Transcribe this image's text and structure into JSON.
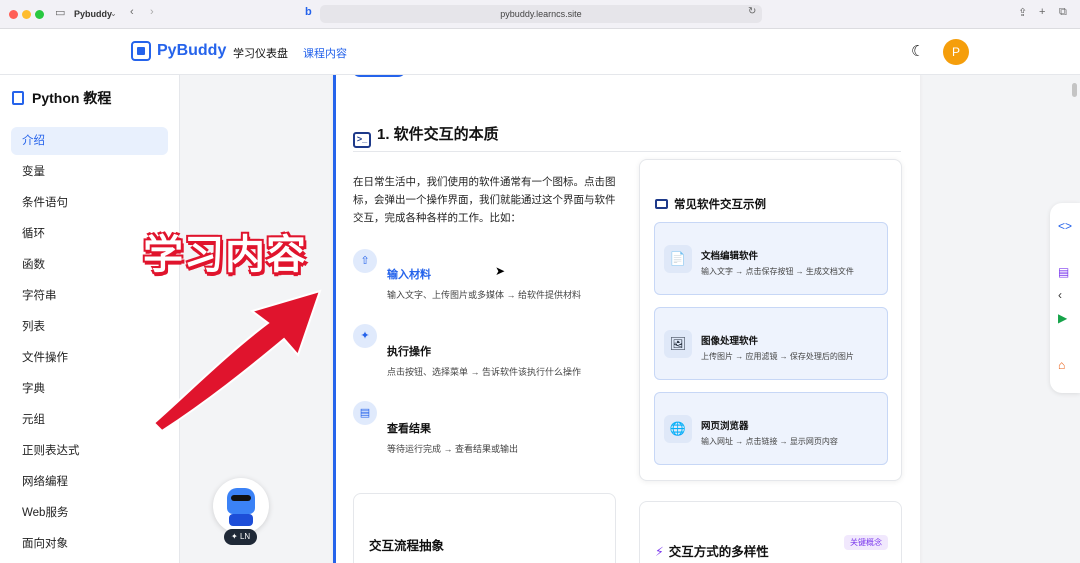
{
  "browser": {
    "tab_title": "Pybuddy",
    "url": "pybuddy.learncs.site",
    "colors": {
      "close": "#ff5f57",
      "minimize": "#febc2e",
      "maximize": "#28c840"
    }
  },
  "header": {
    "brand": "PyBuddy",
    "nav": [
      "学习仪表盘",
      "课程内容"
    ],
    "active_nav": "课程内容",
    "avatar_letter": "P",
    "accent": "#2563eb"
  },
  "sidebar": {
    "title": "Python 教程",
    "items": [
      "介绍",
      "变量",
      "条件语句",
      "循环",
      "函数",
      "字符串",
      "列表",
      "文件操作",
      "字典",
      "元组",
      "正则表达式",
      "网络编程",
      "Web服务",
      "面向对象"
    ],
    "active_item": "介绍"
  },
  "main": {
    "section_title": "1. 软件交互的本质",
    "intro": "在日常生活中，我们使用的软件通常有一个图标。点击图标，会弹出一个操作界面，我们就能通过这个界面与软件交互，完成各种各样的工作。比如：",
    "steps": [
      {
        "icon": "upload-icon",
        "title": "输入材料",
        "desc": "输入文字、上传图片或多媒体 → 给软件提供材料"
      },
      {
        "icon": "click-icon",
        "title": "执行操作",
        "desc": "点击按钮、选择菜单 → 告诉软件该执行什么操作"
      },
      {
        "icon": "document-icon",
        "title": "查看结果",
        "desc": "等待运行完成 → 查看结果或输出"
      }
    ],
    "examples_title": "常见软件交互示例",
    "examples": [
      {
        "icon": "document-edit-icon",
        "title": "文档编辑软件",
        "desc": "输入文字 → 点击保存按钮 → 生成文档文件"
      },
      {
        "icon": "image-icon",
        "title": "图像处理软件",
        "desc": "上传图片 → 应用滤镜 → 保存处理后的图片"
      },
      {
        "icon": "globe-icon",
        "title": "网页浏览器",
        "desc": "输入网址 → 点击链接 → 显示网页内容"
      }
    ],
    "flow_title": "交互流程抽象",
    "diversity_title": "交互方式的多样性",
    "diversity_badge": "关键概念"
  },
  "overlay": {
    "text": "学习内容",
    "color": "#e0142d"
  },
  "mascot_badge": "LN"
}
